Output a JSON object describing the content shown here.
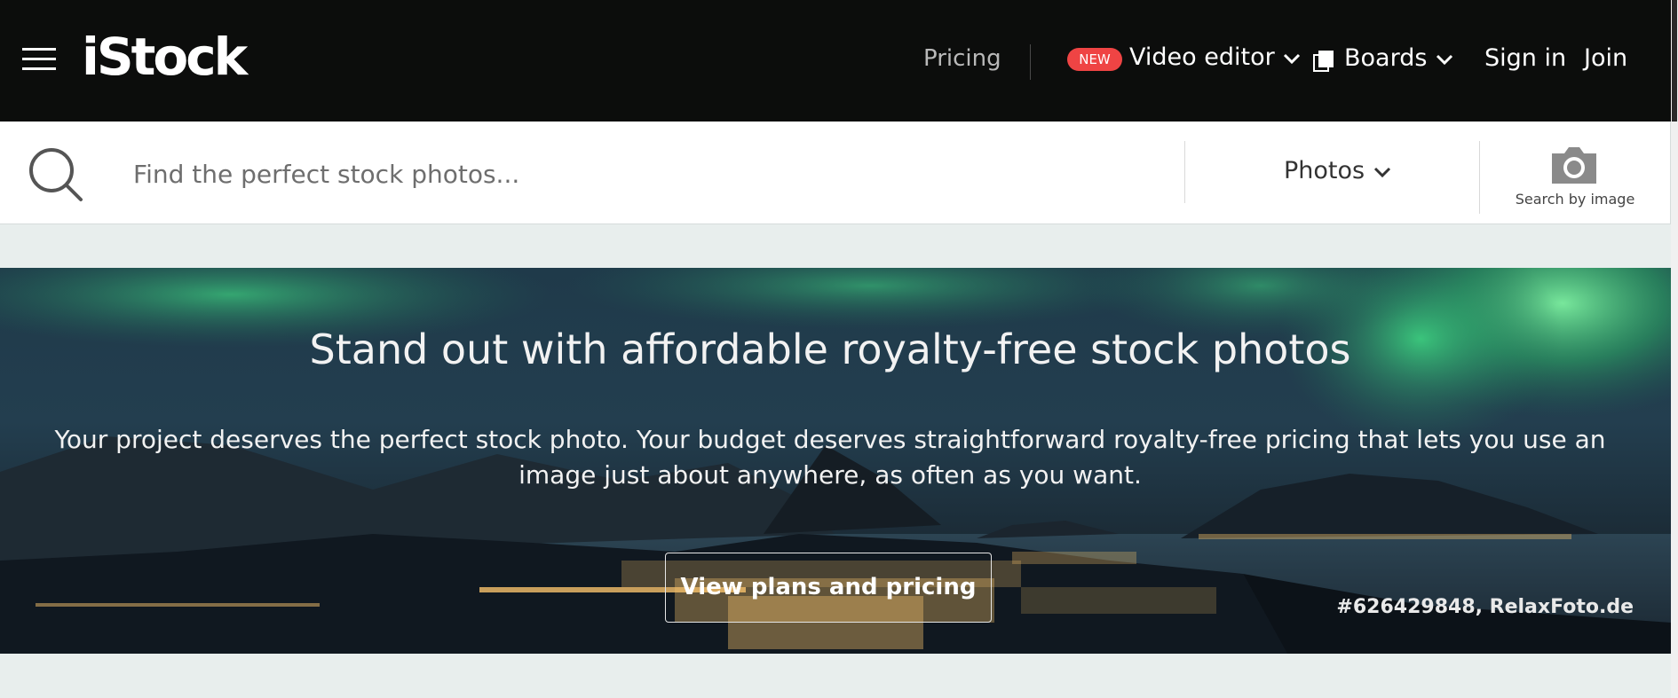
{
  "nav": {
    "logo": "iStock",
    "pricing": "Pricing",
    "new_badge": "NEW",
    "video_editor": "Video editor",
    "boards": "Boards",
    "sign_in": "Sign in",
    "join": "Join"
  },
  "search": {
    "placeholder": "Find the perfect stock photos...",
    "media_type": "Photos",
    "search_by_image": "Search by image"
  },
  "hero": {
    "title": "Stand out with affordable royalty-free stock photos",
    "subtitle": "Your project deserves the perfect stock photo. Your budget deserves straightforward royalty-free pricing that lets you use an image just about anywhere, as often as you want.",
    "button": "View plans and pricing",
    "credit": "#626429848, RelaxFoto.de"
  },
  "colors": {
    "nav_bg": "#0c0d0c",
    "badge": "#ef4444",
    "page_bg": "#e8eeed"
  }
}
